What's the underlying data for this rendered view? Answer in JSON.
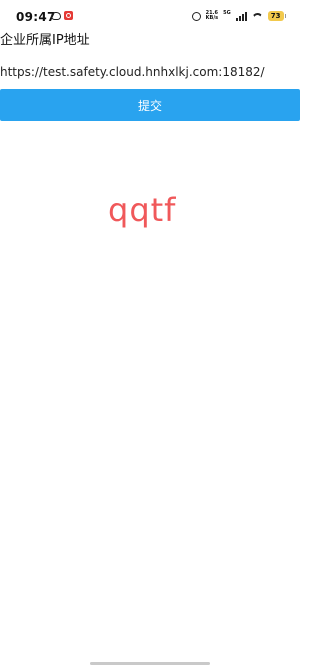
{
  "status_bar": {
    "time": "09:47",
    "net_speed_value": "21.6",
    "net_speed_unit": "KB/s",
    "network_type": "5G",
    "battery_level": "73"
  },
  "form": {
    "label": "企业所属IP地址",
    "url_value": "https://test.safety.cloud.hnhxlkj.com:18182/",
    "submit_label": "提交"
  },
  "captcha_text": "qqtf",
  "colors": {
    "button": "#29a3ef",
    "captcha": "#f0585a",
    "battery": "#f2c94c"
  }
}
